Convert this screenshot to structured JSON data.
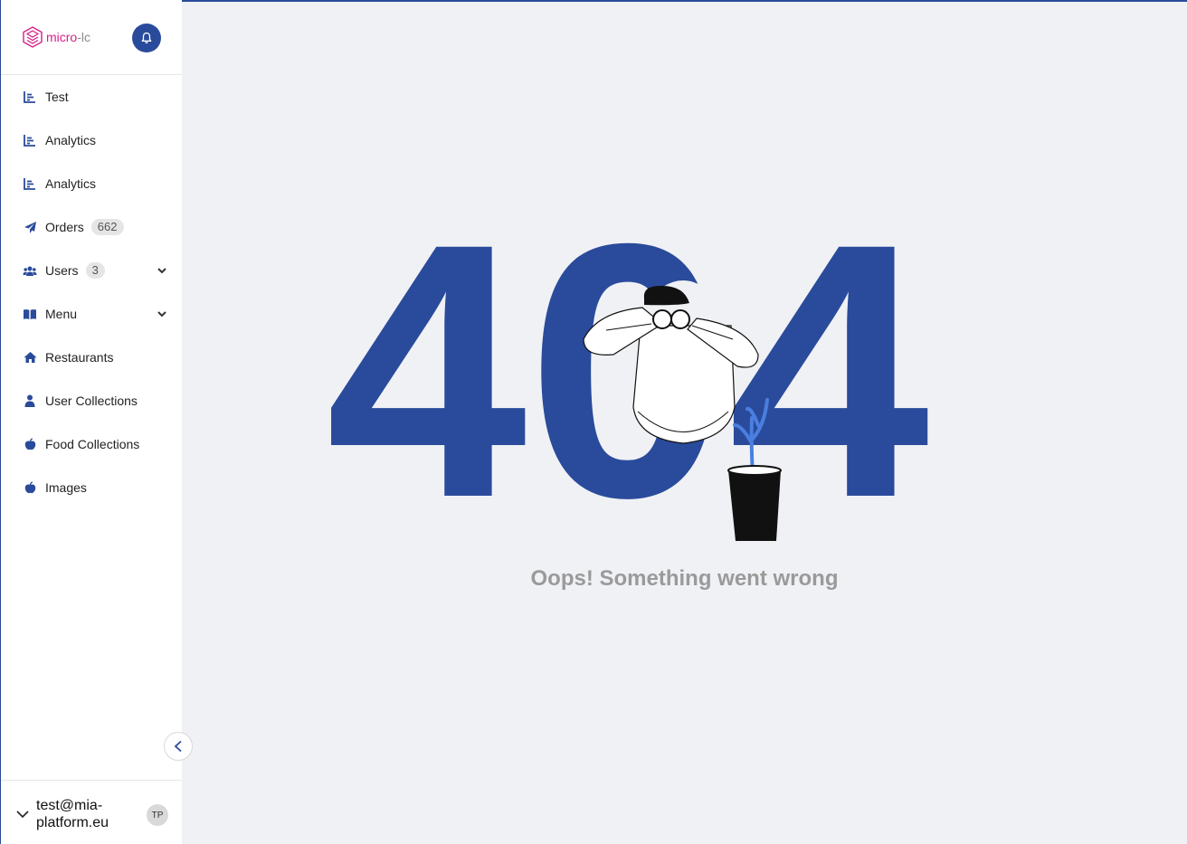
{
  "app": {
    "logo_main": "micro",
    "logo_dash": "-",
    "logo_suffix": "lc"
  },
  "colors": {
    "accent": "#2a4b9b",
    "brand_pink": "#d61e8a",
    "background": "#f0f1f5"
  },
  "sidebar": {
    "items": [
      {
        "label": "Test",
        "icon": "chart-icon"
      },
      {
        "label": "Analytics",
        "icon": "chart-icon"
      },
      {
        "label": "Analytics",
        "icon": "chart-icon"
      },
      {
        "label": "Orders",
        "icon": "paper-plane-icon",
        "badge": "662"
      },
      {
        "label": "Users",
        "icon": "users-icon",
        "badge": "3",
        "expandable": true
      },
      {
        "label": "Menu",
        "icon": "book-icon",
        "expandable": true
      },
      {
        "label": "Restaurants",
        "icon": "home-icon"
      },
      {
        "label": "User Collections",
        "icon": "user-icon"
      },
      {
        "label": "Food Collections",
        "icon": "apple-icon"
      },
      {
        "label": "Images",
        "icon": "apple-icon"
      }
    ]
  },
  "footer": {
    "user_email": "test@mia-platform.eu",
    "avatar_initials": "TP"
  },
  "error": {
    "code": "404",
    "message": "Oops! Something went wrong"
  }
}
